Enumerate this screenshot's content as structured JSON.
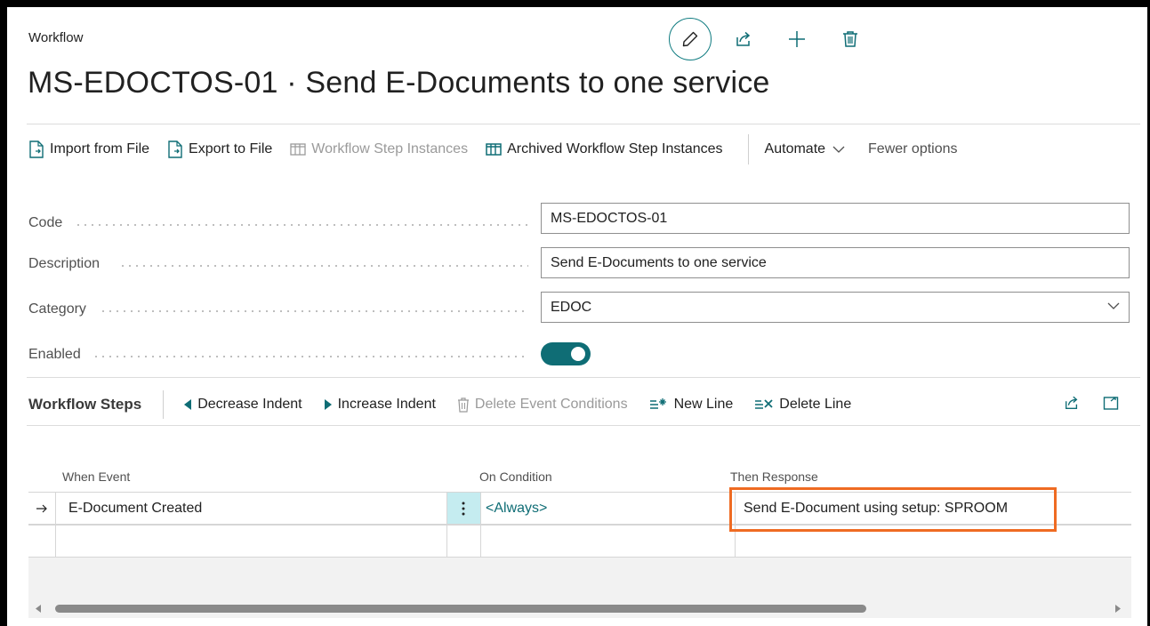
{
  "window": {
    "breadcrumb": "Workflow",
    "title": "MS-EDOCTOS-01 · Send E-Documents to one service"
  },
  "top_actions": [
    "pencil-icon",
    "share-icon",
    "plus-icon",
    "trash-icon"
  ],
  "action_bar": {
    "import": "Import from File",
    "export": "Export to File",
    "step_instances": "Workflow Step Instances",
    "archived": "Archived Workflow Step Instances",
    "automate": "Automate",
    "fewer": "Fewer options"
  },
  "fields": {
    "code": {
      "label": "Code",
      "value": "MS-EDOCTOS-01"
    },
    "description": {
      "label": "Description",
      "value": "Send E-Documents to one service"
    },
    "category": {
      "label": "Category",
      "value": "EDOC"
    },
    "enabled": {
      "label": "Enabled",
      "value": true
    }
  },
  "steps": {
    "title": "Workflow Steps",
    "decrease_indent": "Decrease Indent",
    "increase_indent": "Increase Indent",
    "delete_conditions": "Delete Event Conditions",
    "new_line": "New Line",
    "delete_line": "Delete Line"
  },
  "grid": {
    "columns": [
      "When Event",
      "On Condition",
      "Then Response"
    ],
    "rows": [
      {
        "when_event": "E-Document Created",
        "on_condition": "<Always>",
        "then_response": "Send E-Document using setup: SPROOM"
      }
    ]
  },
  "colors": {
    "accent": "#0f6d75",
    "highlight": "#ef6b22",
    "menu_cell": "#c5ecf0"
  }
}
